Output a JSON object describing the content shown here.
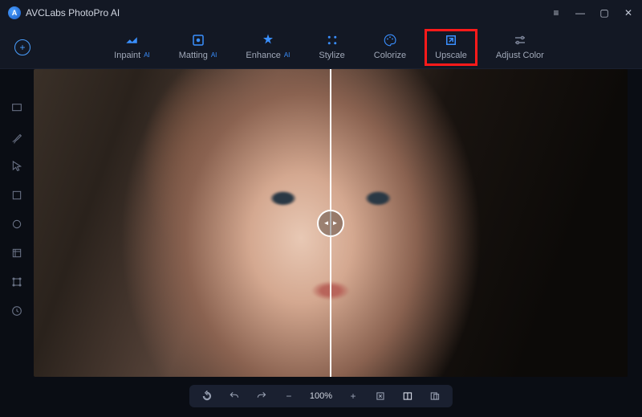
{
  "app": {
    "title": "AVCLabs PhotoPro AI"
  },
  "toolbar": {
    "items": [
      {
        "label": "Inpaint",
        "ai": true,
        "icon": "inpaint-icon"
      },
      {
        "label": "Matting",
        "ai": true,
        "icon": "matting-icon"
      },
      {
        "label": "Enhance",
        "ai": true,
        "icon": "enhance-icon"
      },
      {
        "label": "Stylize",
        "ai": false,
        "icon": "stylize-icon"
      },
      {
        "label": "Colorize",
        "ai": false,
        "icon": "colorize-icon"
      },
      {
        "label": "Upscale",
        "ai": false,
        "icon": "upscale-icon",
        "highlighted": true
      },
      {
        "label": "Adjust Color",
        "ai": false,
        "icon": "adjust-color-icon"
      }
    ],
    "ai_badge": "AI"
  },
  "side_tools": [
    "move-tool",
    "brush-tool",
    "pointer-tool",
    "rect-select-tool",
    "ellipse-select-tool",
    "crop-tool",
    "transform-tool",
    "history-tool"
  ],
  "bottom": {
    "zoom": "100%",
    "items": [
      "rotate",
      "undo",
      "redo",
      "zoom-out",
      "zoom-text",
      "zoom-in",
      "fit",
      "compare",
      "original"
    ]
  },
  "colors": {
    "accent": "#3a8fff",
    "highlight": "#ff1a1a"
  }
}
